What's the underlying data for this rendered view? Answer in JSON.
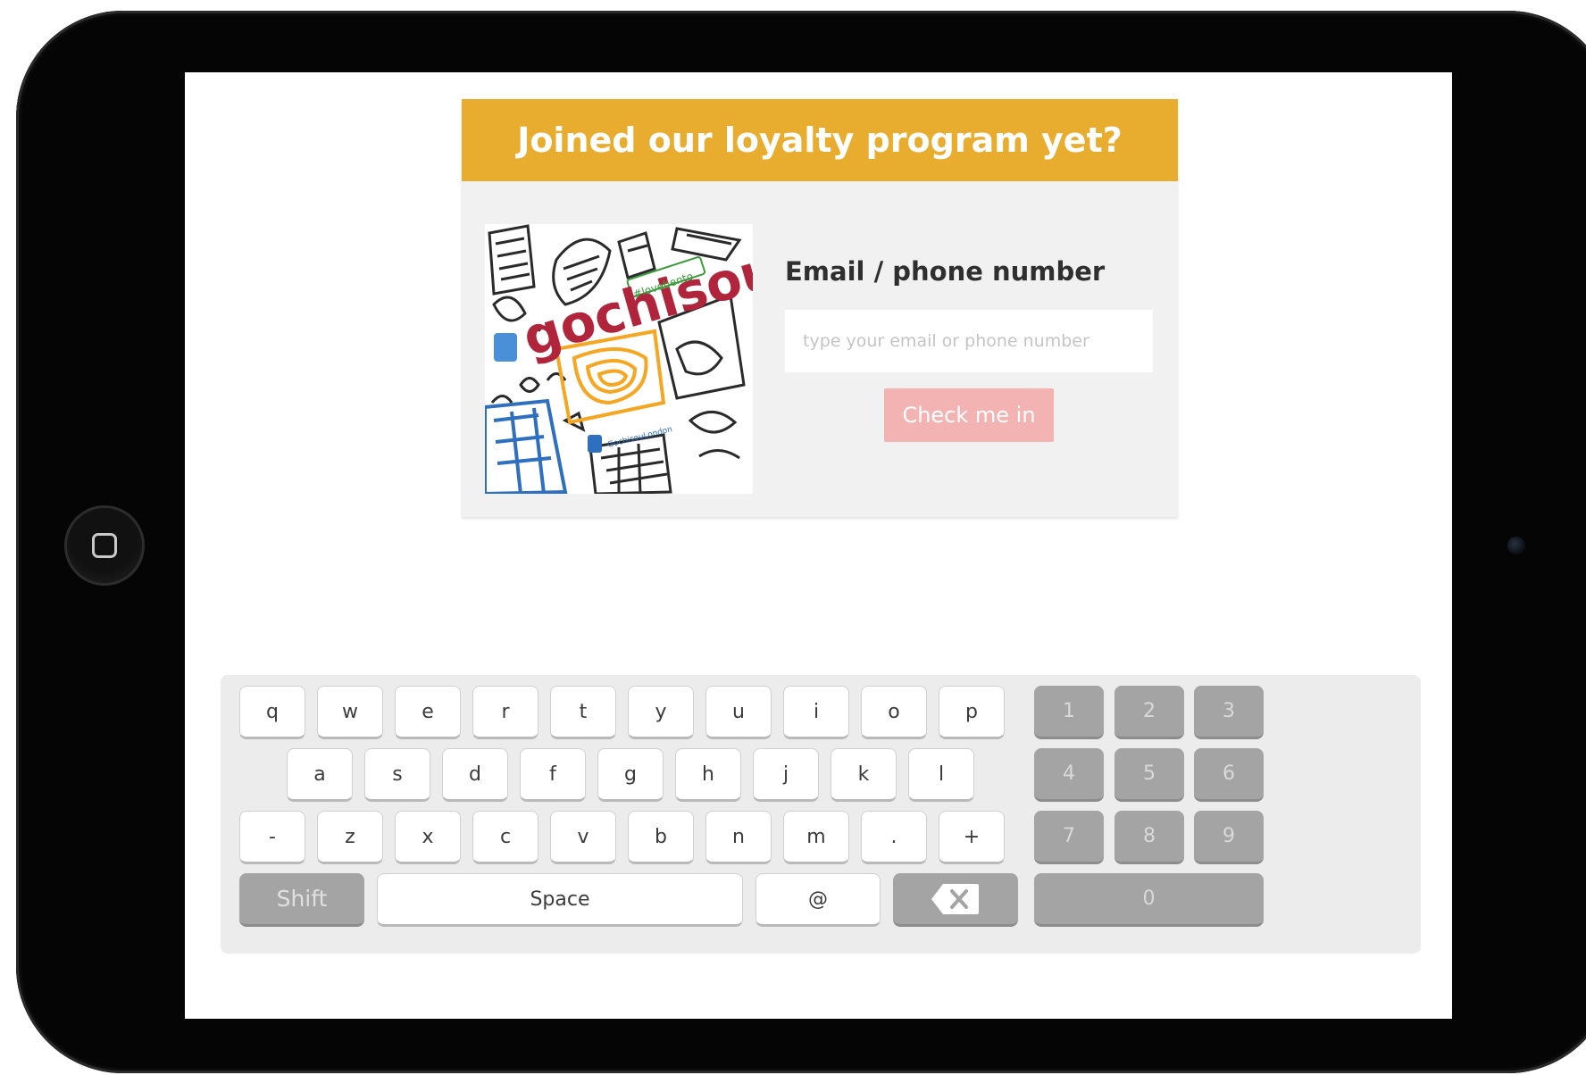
{
  "card": {
    "title": "Joined our loyalty program yet?",
    "field_label": "Email / phone number",
    "input_placeholder": "type your email or phone number",
    "input_value": "",
    "button_label": "Check me in"
  },
  "promo": {
    "brand_text": "gochisou",
    "tag_text": "#lovebento",
    "social_text": "GochisouLondon"
  },
  "keyboard": {
    "rows": [
      [
        "q",
        "w",
        "e",
        "r",
        "t",
        "y",
        "u",
        "i",
        "o",
        "p"
      ],
      [
        "a",
        "s",
        "d",
        "f",
        "g",
        "h",
        "j",
        "k",
        "l"
      ],
      [
        "-",
        "z",
        "x",
        "c",
        "v",
        "b",
        "n",
        "m",
        ".",
        "+"
      ]
    ],
    "numpad": [
      "1",
      "2",
      "3",
      "4",
      "5",
      "6",
      "7",
      "8",
      "9"
    ],
    "shift_label": "Shift",
    "space_label": "Space",
    "at_label": "@",
    "zero_label": "0",
    "backspace_icon": "backspace-icon"
  },
  "colors": {
    "header": "#e8ac2e",
    "button": "#f3b3b2",
    "brand_red": "#b0243c",
    "brand_orange": "#f5a623",
    "accent_blue": "#2f6fc0"
  }
}
